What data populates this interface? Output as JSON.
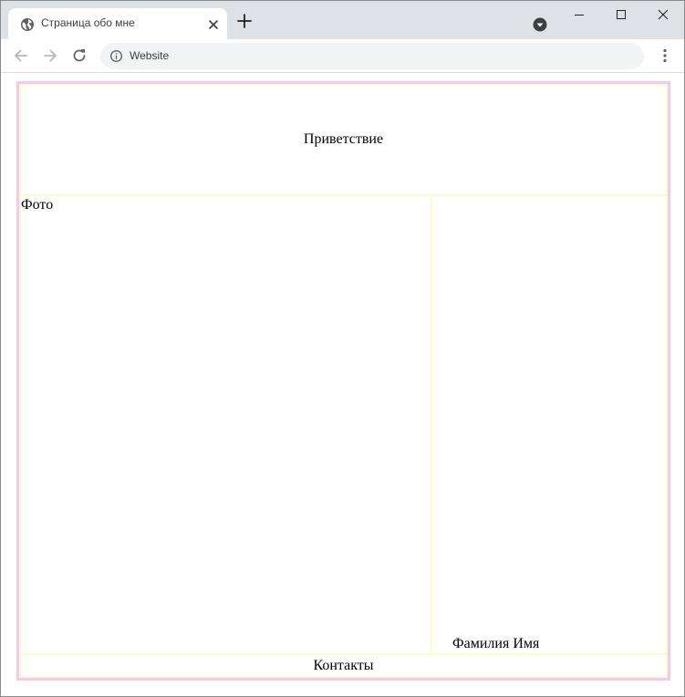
{
  "browser": {
    "tab": {
      "title": "Страница обо мне",
      "favicon": "globe-icon"
    },
    "new_tab_icon": "plus-icon",
    "profile_icon": "profile-dropdown-icon",
    "window_controls": [
      "minimize-icon",
      "maximize-icon",
      "close-icon"
    ],
    "nav": {
      "back_icon": "arrow-left-icon",
      "forward_icon": "arrow-right-icon",
      "reload_icon": "reload-icon"
    },
    "address_bar": {
      "info_icon": "info-icon",
      "text": "Website"
    },
    "menu_icon": "kebab-menu-icon"
  },
  "page": {
    "header": {
      "text": "Приветствие"
    },
    "photo": {
      "label": "Фото"
    },
    "name": {
      "text": "Фамилия Имя"
    },
    "footer": {
      "text": "Контакты"
    }
  },
  "colors": {
    "outer_border": "#f5c8f3",
    "cell_border": "#fdfbc6",
    "tabstrip_bg": "#dee1e6",
    "omnibox_bg": "#f1f3f4"
  }
}
